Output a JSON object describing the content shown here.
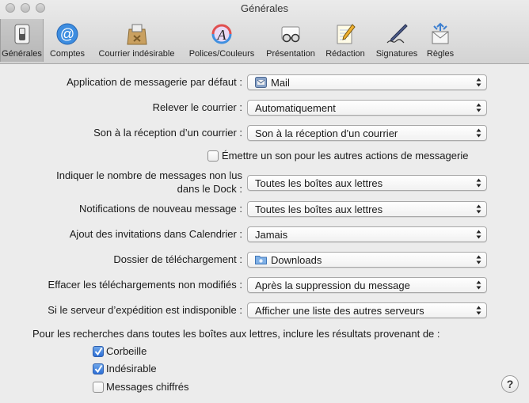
{
  "window": {
    "title": "Générales"
  },
  "toolbar": {
    "items": [
      {
        "label": "Générales",
        "icon": "switch-icon",
        "selected": true
      },
      {
        "label": "Comptes",
        "icon": "at-sign-icon"
      },
      {
        "label": "Courrier indésirable",
        "icon": "junk-mail-bag-icon"
      },
      {
        "label": "Polices/Couleurs",
        "icon": "font-colors-icon"
      },
      {
        "label": "Présentation",
        "icon": "glasses-icon"
      },
      {
        "label": "Rédaction",
        "icon": "notepad-pencil-icon"
      },
      {
        "label": "Signatures",
        "icon": "pen-signature-icon"
      },
      {
        "label": "Règles",
        "icon": "rules-envelope-icon"
      }
    ]
  },
  "settings": {
    "default_app": {
      "label": "Application de messagerie par défaut :",
      "value": "Mail",
      "icon": "mail-app-icon"
    },
    "check_mail": {
      "label": "Relever le courrier :",
      "value": "Automatiquement"
    },
    "new_mail_sound": {
      "label": "Son à la réception d’un courrier :",
      "value": "Son à la réception d'un courrier"
    },
    "other_sounds": {
      "label": "Émettre un son pour les autres actions de messagerie",
      "checked": false
    },
    "dock_unread": {
      "label_line1": "Indiquer le nombre de messages non lus",
      "label_line2": "dans le Dock :",
      "value": "Toutes les boîtes aux lettres"
    },
    "notifications": {
      "label": "Notifications de nouveau message :",
      "value": "Toutes les boîtes aux lettres"
    },
    "calendar_invites": {
      "label": "Ajout des invitations dans Calendrier :",
      "value": "Jamais"
    },
    "download_folder": {
      "label": "Dossier de téléchargement :",
      "value": "Downloads",
      "icon": "folder-icon"
    },
    "remove_downloads": {
      "label": "Effacer les téléchargements non modifiés :",
      "value": "Après la suppression du message"
    },
    "outgoing_unavailable": {
      "label": "Si le serveur d’expédition est indisponible :",
      "value": "Afficher une liste des autres serveurs"
    },
    "search_include": {
      "label": "Pour les recherches dans toutes les boîtes aux lettres, inclure les résultats provenant de :",
      "options": [
        {
          "label": "Corbeille",
          "checked": true
        },
        {
          "label": "Indésirable",
          "checked": true
        },
        {
          "label": "Messages chiffrés",
          "checked": false
        }
      ]
    }
  },
  "help": {
    "label": "?"
  },
  "colors": {
    "checkbox_checked": "#2d6fd6",
    "window_bg": "#ececec"
  }
}
